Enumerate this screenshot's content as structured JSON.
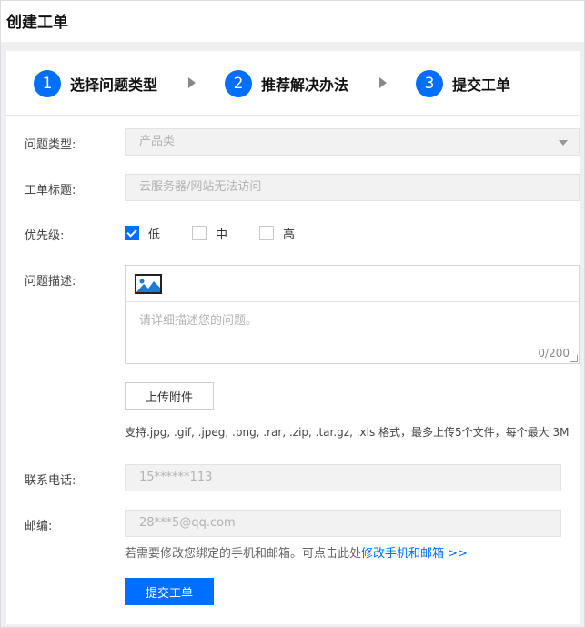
{
  "page": {
    "title": "创建工单"
  },
  "steps": [
    {
      "num": "1",
      "label": "选择问题类型"
    },
    {
      "num": "2",
      "label": "推荐解决办法"
    },
    {
      "num": "3",
      "label": "提交工单"
    }
  ],
  "form": {
    "type": {
      "label": "问题类型:",
      "value": "产品类"
    },
    "subject": {
      "label": "工单标题:",
      "placeholder": "云服务器/网站无法访问"
    },
    "priority": {
      "label": "优先级:",
      "options": [
        {
          "label": "低",
          "checked": true
        },
        {
          "label": "中",
          "checked": false
        },
        {
          "label": "高",
          "checked": false
        }
      ]
    },
    "description": {
      "label": "问题描述:",
      "toolbar_icon": "image-icon",
      "placeholder": "请详细描述您的问题。",
      "counter": "0/200"
    },
    "upload": {
      "button": "上传附件",
      "hint": "支持.jpg, .gif, .jpeg, .png, .rar, .zip, .tar.gz, .xls 格式，最多上传5个文件，每个最大 3M"
    },
    "phone": {
      "label": "联系电话:",
      "value": "15******113"
    },
    "email": {
      "label": "邮编:",
      "value": "28***5@qq.com"
    },
    "note": {
      "text": "若需要修改您绑定的手机和邮箱。可点击此处",
      "link": "修改手机和邮箱 >>"
    },
    "submit": "提交工单"
  },
  "colors": {
    "accent": "#006eff",
    "checkbox_checked": "#006eff",
    "arrow": "#888888"
  }
}
